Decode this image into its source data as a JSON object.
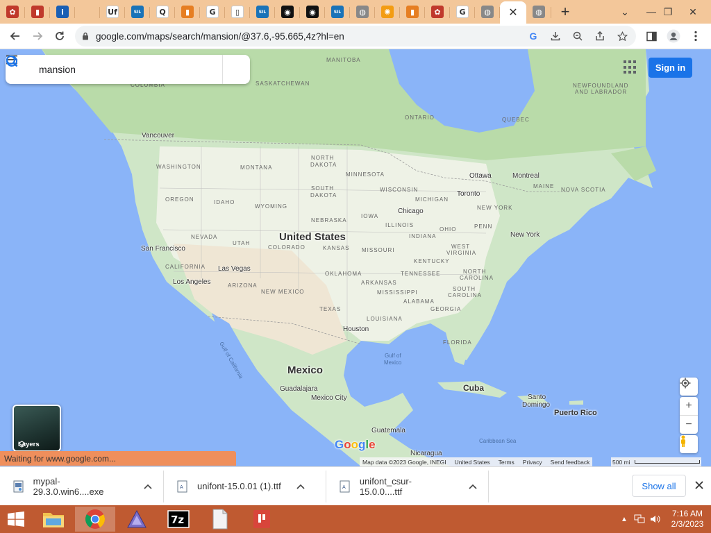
{
  "tabs": {
    "favicons": [
      {
        "icon": "brain-icon",
        "bg": "#c0392b",
        "glyph": "✿"
      },
      {
        "icon": "red-square-icon",
        "bg": "#c0392b",
        "glyph": "▮"
      },
      {
        "icon": "info-icon",
        "bg": "#1a5fb4",
        "glyph": "i"
      },
      {
        "icon": "blank-icon",
        "bg": "transparent",
        "glyph": ""
      },
      {
        "icon": "uf-icon",
        "bg": "#ffffff",
        "glyph": "Uf"
      },
      {
        "icon": "sil-icon",
        "bg": "#1a73b8",
        "glyph": "SIL"
      },
      {
        "icon": "quora-icon",
        "bg": "#ffffff",
        "glyph": "Q"
      },
      {
        "icon": "colorful-icon",
        "bg": "#e67e22",
        "glyph": "▮"
      },
      {
        "icon": "google-icon",
        "bg": "#ffffff",
        "glyph": "G"
      },
      {
        "icon": "page-icon",
        "bg": "#ffffff",
        "glyph": "▯"
      },
      {
        "icon": "sil-icon",
        "bg": "#1a73b8",
        "glyph": "SIL"
      },
      {
        "icon": "record-icon",
        "bg": "#111111",
        "glyph": "◉"
      },
      {
        "icon": "record-icon",
        "bg": "#111111",
        "glyph": "◉"
      },
      {
        "icon": "sil-icon",
        "bg": "#1a73b8",
        "glyph": "SIL"
      },
      {
        "icon": "globe-icon",
        "bg": "#888888",
        "glyph": "◍"
      },
      {
        "icon": "sun-icon",
        "bg": "#f39c12",
        "glyph": "✺"
      },
      {
        "icon": "colorful-icon",
        "bg": "#e67e22",
        "glyph": "▮"
      },
      {
        "icon": "brain-icon",
        "bg": "#c0392b",
        "glyph": "✿"
      },
      {
        "icon": "google-icon",
        "bg": "#ffffff",
        "glyph": "G"
      },
      {
        "icon": "globe-icon",
        "bg": "#888888",
        "glyph": "◍"
      }
    ],
    "active_close": "✕",
    "after_active": {
      "icon": "globe-icon",
      "bg": "#888888",
      "glyph": "◍"
    },
    "new_tab": "+"
  },
  "window_controls": {
    "dropdown": "⌄",
    "minimize": "—",
    "restore": "❐",
    "close": "✕"
  },
  "toolbar": {
    "url": "google.com/maps/search/mansion/@37.6,-95.665,4z?hl=en"
  },
  "maps": {
    "search_query": "mansion",
    "signin_label": "Sign in",
    "layers_label": "Layers",
    "google_logo": "Google",
    "attribution": [
      "Map data ©2023 Google, INEGI",
      "United States",
      "Terms",
      "Privacy",
      "Send feedback"
    ],
    "scale_label": "500 mi",
    "status_text": "Waiting for www.google.com...",
    "region_labels": [
      "MANITOBA",
      "SASKATCHEWAN",
      "COLUMBIA",
      "ONTARIO",
      "QUEBEC",
      "NEWFOUNDLAND",
      "AND LABRADOR",
      "NORTH",
      "DAKOTA",
      "SOUTH",
      "DAKOTA",
      "MINNESOTA",
      "WISCONSIN",
      "MICHIGAN",
      "WASHINGTON",
      "MONTANA",
      "OREGON",
      "IDAHO",
      "WYOMING",
      "NEBRASKA",
      "IOWA",
      "ILLINOIS",
      "INDIANA",
      "OHIO",
      "PENN",
      "NEW YORK",
      "MAINE",
      "NOVA SCOTIA",
      "NEVADA",
      "UTAH",
      "COLORADO",
      "KANSAS",
      "MISSOURI",
      "WEST",
      "VIRGINIA",
      "KENTUCKY",
      "CALIFORNIA",
      "ARIZONA",
      "NEW MEXICO",
      "OKLAHOMA",
      "ARKANSAS",
      "TENNESSEE",
      "NORTH",
      "CAROLINA",
      "SOUTH",
      "CAROLINA",
      "MISSISSIPPI",
      "ALABAMA",
      "GEORGIA",
      "TEXAS",
      "LOUISIANA",
      "FLORIDA"
    ],
    "cities": [
      "Vancouver",
      "Ottawa",
      "Montreal",
      "Toronto",
      "Chicago",
      "New York",
      "San Francisco",
      "Las Vegas",
      "Los Angeles",
      "Houston",
      "Guadalajara",
      "Mexico City",
      "Guatemala",
      "Nicaragua",
      "Santo",
      "Domingo"
    ],
    "countries": [
      "United States",
      "Mexico",
      "Cuba",
      "Puerto Rico"
    ],
    "water_labels": [
      "Gulf of",
      "Mexico",
      "Gulf of California",
      "Caribbean Sea"
    ]
  },
  "downloads": {
    "items": [
      {
        "name": "mypal-29.3.0.win6....exe"
      },
      {
        "name": "unifont-15.0.01 (1).ttf"
      },
      {
        "name": "unifont_csur-15.0.0....ttf"
      }
    ],
    "show_all": "Show all"
  },
  "taskbar": {
    "time": "7:16 AM",
    "date": "2/3/2023"
  },
  "colors": {
    "tabstrip": "#f3c79a",
    "taskbar": "#bf5a31",
    "status": "#ef8f5c",
    "accent": "#1a73e8",
    "ocean": "#8ab4f8",
    "land": "#d4ead0"
  }
}
